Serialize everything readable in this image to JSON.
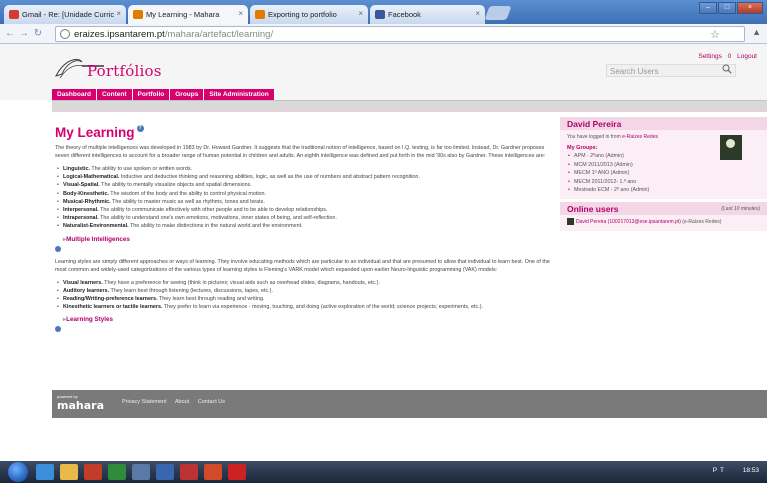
{
  "browser": {
    "tabs": [
      {
        "label": "Gmail - Re: [Unidade Curric",
        "icon": "gmail-icon",
        "color": "#d63b2f"
      },
      {
        "label": "My Learning - Mahara",
        "icon": "mahara-icon",
        "color": "#e07b00"
      },
      {
        "label": "Exporting to portfolio",
        "icon": "mahara-icon",
        "color": "#e07b00"
      },
      {
        "label": "Facebook",
        "icon": "facebook-icon",
        "color": "#3b5998"
      }
    ],
    "url_host": "eraizes.ipsantarem.pt",
    "url_path": "/mahara/artefact/learning/"
  },
  "header": {
    "logo_text": "Portfólios",
    "toplinks": {
      "settings": "Settings",
      "inbox": "0",
      "logout": "Logout"
    },
    "search_placeholder": "Search Users",
    "nav": [
      "Dashboard",
      "Content",
      "Portfolio",
      "Groups",
      "Site Administration"
    ]
  },
  "main": {
    "title": "My Learning",
    "intro": "The theory of multiple intelligences was developed in 1983 by Dr. Howard Gardner. It suggests that the traditional notion of intelligence, based on I.Q. testing, is far too limited. Instead, Dr. Gardner proposes seven different intelligences to account for a broader range of human potential in children and adults. An eighth intelligence was defined and put forth in the mid '90s also by Gardner. These intelligences are:",
    "intelligences": [
      {
        "name": "Linguistic.",
        "text": "The ability to use spoken or written words."
      },
      {
        "name": "Logical-Mathematical.",
        "text": "Inductive and deductive thinking and reasoning abilities, logic, as well as the use of numbers and abstract pattern recognition."
      },
      {
        "name": "Visual-Spatial.",
        "text": "The ability to mentally visualize objects and spatial dimensions."
      },
      {
        "name": "Body-Kinesthetic.",
        "text": "The wisdom of the body and the ability to control physical motion."
      },
      {
        "name": "Musical-Rhythmic.",
        "text": "The ability to master music as well as rhythms, tones and beats."
      },
      {
        "name": "Interpersonal.",
        "text": "The ability to communicate effectively with other people and to be able to develop relationships."
      },
      {
        "name": "Intrapersonal.",
        "text": "The ability to understand one's own emotions, motivations, inner states of being, and self-reflection."
      },
      {
        "name": "Naturalist-Environmental.",
        "text": "The ability to make distinctions in the natural world and the environment."
      }
    ],
    "expander1": "Multiple Intelligences",
    "styles_intro": "Learning styles are simply different approaches or ways of learning. They involve educating methods which are particular to an individual and that are presumed to allow that individual to learn best. One of the most common and widely-used categorizations of the various types of learning styles is Fleming's VARK model which expanded upon earlier Neuro-linguistic programming (VAK) models:",
    "styles": [
      {
        "name": "Visual learners.",
        "text": "They have a preference for seeing (think in pictures; visual aids such as overhead slides, diagrams, handouts, etc.)."
      },
      {
        "name": "Auditory learners.",
        "text": "They learn best through listening (lectures, discussions, tapes, etc.)."
      },
      {
        "name": "Reading/Writing-preference learners.",
        "text": "They learn best through reading and writing."
      },
      {
        "name": "Kinesthetic learners or tactile learners.",
        "text": "They prefer to learn via experience - moving, touching, and doing (active exploration of the world; science projects; experiments, etc.)."
      }
    ],
    "expander2": "Learning Styles"
  },
  "footer": {
    "powered_by": "powered by",
    "brand": "mahara",
    "links": [
      "Privacy Statement",
      "About",
      "Contact Us"
    ]
  },
  "sidebar": {
    "user_name": "David Pereira",
    "login_prefix": "You have logged in from",
    "login_source": "e-Raízes Redes",
    "my_groups_label": "My Groups:",
    "groups": [
      "APM - 2ºano (Admin)",
      "MCM 2011/2013 (Admin)",
      "MECM 1º ANO (Admin)",
      "MECM 2011/2012- 1.º ano",
      "Mestrado ECM - 2º ano (Admin)"
    ],
    "online_title": "Online users",
    "online_window": "(Last 10 minutes)",
    "online_user": "David Pereira (100217013@ese.ipsantarem.pt)",
    "online_suffix": "(e-Raízes Redes)"
  },
  "taskbar": {
    "language": "PT",
    "time": "18:53"
  }
}
